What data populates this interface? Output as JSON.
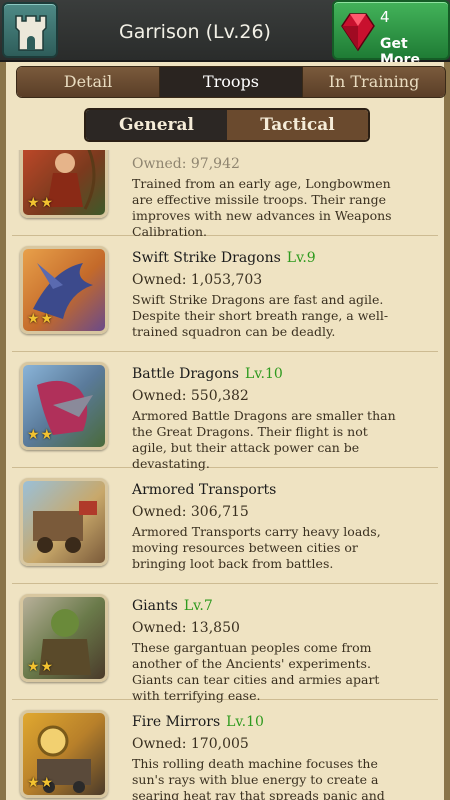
{
  "header": {
    "title": "Garrison (Lv.26)",
    "gem_count": "4",
    "get_more_label": "Get More"
  },
  "tabs": [
    {
      "label": "Detail",
      "active": false
    },
    {
      "label": "Troops",
      "active": true
    },
    {
      "label": "In Training",
      "active": false
    }
  ],
  "subtabs": [
    {
      "label": "General",
      "active": true
    },
    {
      "label": "Tactical",
      "active": false
    }
  ],
  "troops": [
    {
      "name": "",
      "level": "",
      "owned": "Owned: 97,942",
      "description": "Trained from an early age, Longbowmen are effective missile troops. Their range improves with new advances in Weapons Calibration.",
      "stars": 2
    },
    {
      "name": "Swift Strike Dragons",
      "level": "Lv.9",
      "owned": "Owned: 1,053,703",
      "description": "Swift Strike Dragons are fast and agile. Despite their short breath range, a well-trained squadron can be deadly.",
      "stars": 2
    },
    {
      "name": "Battle Dragons",
      "level": "Lv.10",
      "owned": "Owned: 550,382",
      "description": "Armored Battle Dragons are smaller than the Great Dragons. Their flight is not agile, but their attack power can be devastating.",
      "stars": 2
    },
    {
      "name": "Armored Transports",
      "level": "",
      "owned": "Owned: 306,715",
      "description": "Armored Transports carry heavy loads, moving resources between cities or bringing loot back from battles.",
      "stars": 0
    },
    {
      "name": "Giants",
      "level": "Lv.7",
      "owned": "Owned: 13,850",
      "description": "These gargantuan peoples come from another of the Ancients' experiments. Giants can tear cities and armies apart with terrifying ease.",
      "stars": 2
    },
    {
      "name": "Fire Mirrors",
      "level": "Lv.10",
      "owned": "Owned: 170,005",
      "description": "This rolling death machine focuses the sun's rays with blue energy to create a searing heat ray that spreads panic and destruction.",
      "stars": 2
    }
  ],
  "colors": {
    "parchment": "#efe3c2",
    "level_green": "#2e9a1e",
    "get_more_green": "#2f9a47",
    "castle_teal": "#3e7a76"
  }
}
